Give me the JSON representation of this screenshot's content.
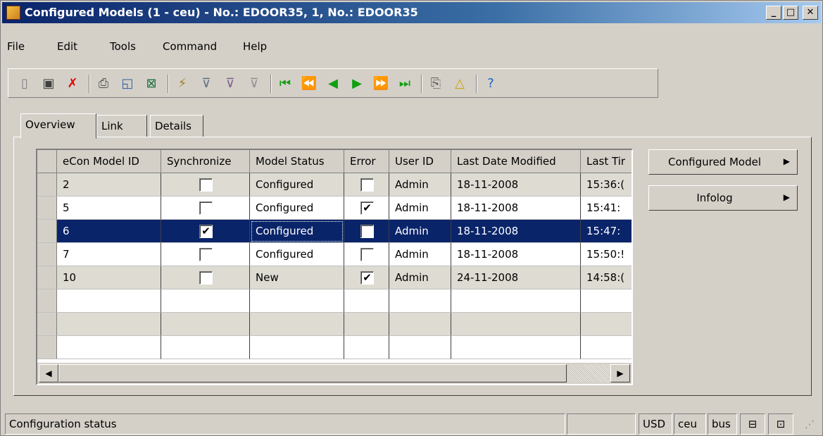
{
  "window": {
    "title": "Configured Models (1 - ceu) - No.: EDOOR35, 1, No.: EDOOR35",
    "controls": [
      "minimize",
      "maximize",
      "close"
    ]
  },
  "menu": [
    "File",
    "Edit",
    "Tools",
    "Command",
    "Help"
  ],
  "toolbar": {
    "icons": [
      "new-icon",
      "save-icon",
      "delete-icon",
      "print-icon",
      "print-preview-icon",
      "export-excel-icon",
      "filter-by-selection-icon",
      "filter-by-grid-icon",
      "advanced-filter-icon",
      "remove-filter-icon",
      "first-record-icon",
      "previous-page-icon",
      "previous-record-icon",
      "next-record-icon",
      "next-page-icon",
      "last-record-icon",
      "attach-document-icon",
      "alert-icon",
      "help-icon"
    ]
  },
  "tabs": [
    "Overview",
    "Link",
    "Details"
  ],
  "grid": {
    "columns": [
      "eCon Model ID",
      "Synchronize",
      "Model Status",
      "Error",
      "User ID",
      "Last Date Modified",
      "Last Tir"
    ],
    "rows": [
      {
        "id": "2",
        "synchronize": false,
        "status": "Configured",
        "error": false,
        "user": "Admin",
        "date": "18-11-2008",
        "time": "15:36:("
      },
      {
        "id": "5",
        "synchronize": false,
        "status": "Configured",
        "error": true,
        "user": "Admin",
        "date": "18-11-2008",
        "time": "15:41:"
      },
      {
        "id": "6",
        "synchronize": true,
        "status": "Configured",
        "error": false,
        "user": "Admin",
        "date": "18-11-2008",
        "time": "15:47:"
      },
      {
        "id": "7",
        "synchronize": false,
        "status": "Configured",
        "error": false,
        "user": "Admin",
        "date": "18-11-2008",
        "time": "15:50:!"
      },
      {
        "id": "10",
        "synchronize": false,
        "status": "New",
        "error": true,
        "user": "Admin",
        "date": "24-11-2008",
        "time": "14:58:("
      }
    ],
    "selected_row_id": "6"
  },
  "side_buttons": {
    "configured_model": "Configured Model",
    "infolog": "Infolog"
  },
  "status": {
    "text": "Configuration status",
    "currency": "USD",
    "company": "ceu",
    "layer": "bus"
  },
  "colors": {
    "selection": "#0a246a",
    "face": "#d4d0c8",
    "titlebar_start": "#0a246a"
  }
}
